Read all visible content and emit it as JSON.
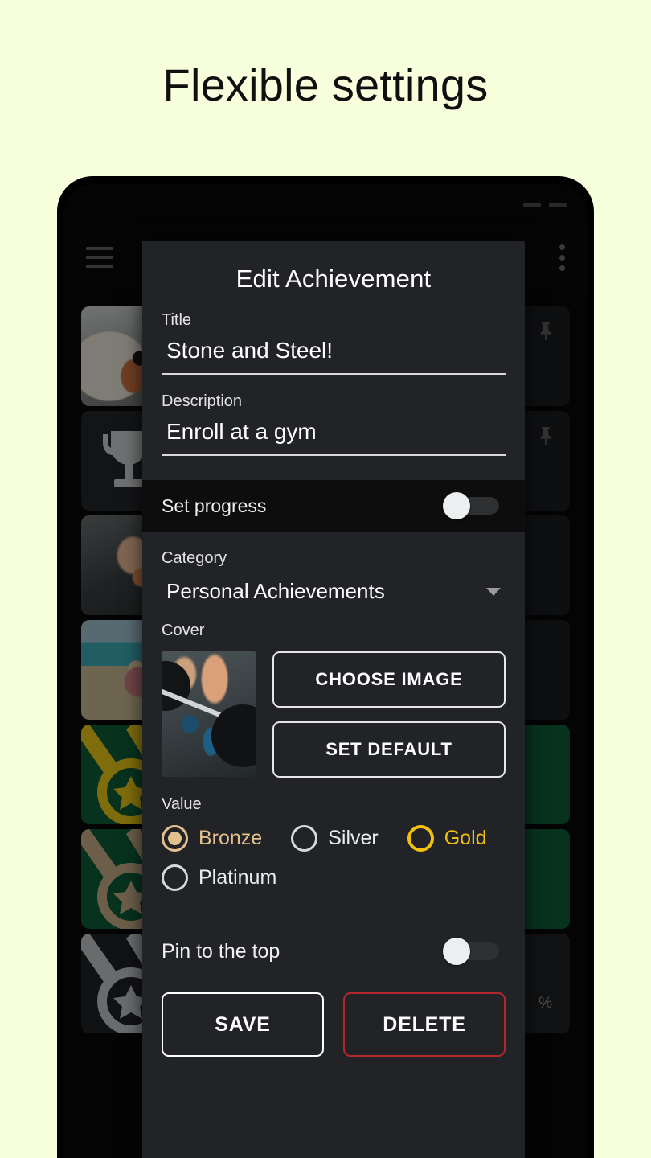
{
  "headline": "Flexible settings",
  "colors": {
    "page_background": "#f8ffdd",
    "dialog_background": "#212326",
    "progress_band": "#0d0d0e",
    "bronze": "#e3c08d",
    "gold": "#f2c10d",
    "silver": "#d6d9dc",
    "delete_border": "#b5272c",
    "card_green": "#0b5c38"
  },
  "app": {
    "menu_icon": "hamburger-menu-icon",
    "overflow_icon": "more-vertical-icon",
    "cards": [
      {
        "thumb": "dog-photo",
        "pinned": true,
        "pin_icon": "pin-icon",
        "progress": ""
      },
      {
        "thumb": "trophy-icon",
        "pinned": true,
        "pin_icon": "pin-icon",
        "progress": ""
      },
      {
        "thumb": "running-shoes-photo",
        "pinned": false,
        "pin_icon": "",
        "progress": ""
      },
      {
        "thumb": "beach-photo",
        "pinned": false,
        "pin_icon": "",
        "progress": ""
      },
      {
        "thumb": "gold-medal-icon",
        "pinned": false,
        "pin_icon": "",
        "progress": ""
      },
      {
        "thumb": "bronze-medal-icon",
        "pinned": false,
        "pin_icon": "",
        "progress": ""
      },
      {
        "thumb": "silver-medal-icon",
        "pinned": false,
        "pin_icon": "",
        "progress": "%"
      }
    ]
  },
  "dialog": {
    "title": "Edit Achievement",
    "title_field": {
      "label": "Title",
      "value": "Stone and Steel!"
    },
    "description_field": {
      "label": "Description",
      "value": "Enroll at a gym"
    },
    "set_progress": {
      "label": "Set progress",
      "checked": false
    },
    "category": {
      "label": "Category",
      "value": "Personal Achievements",
      "caret_icon": "chevron-down-icon"
    },
    "cover": {
      "label": "Cover",
      "thumb_alt": "barbell-deadlift-photo",
      "choose_image_label": "CHOOSE IMAGE",
      "set_default_label": "SET DEFAULT"
    },
    "value": {
      "label": "Value",
      "options": [
        {
          "label": "Bronze",
          "selected": true,
          "style": "bronze"
        },
        {
          "label": "Silver",
          "selected": false,
          "style": "silver"
        },
        {
          "label": "Gold",
          "selected": false,
          "style": "gold"
        },
        {
          "label": "Platinum",
          "selected": false,
          "style": "silver"
        }
      ]
    },
    "pin_to_top": {
      "label": "Pin to the top",
      "checked": false
    },
    "actions": {
      "save_label": "SAVE",
      "delete_label": "DELETE"
    }
  }
}
